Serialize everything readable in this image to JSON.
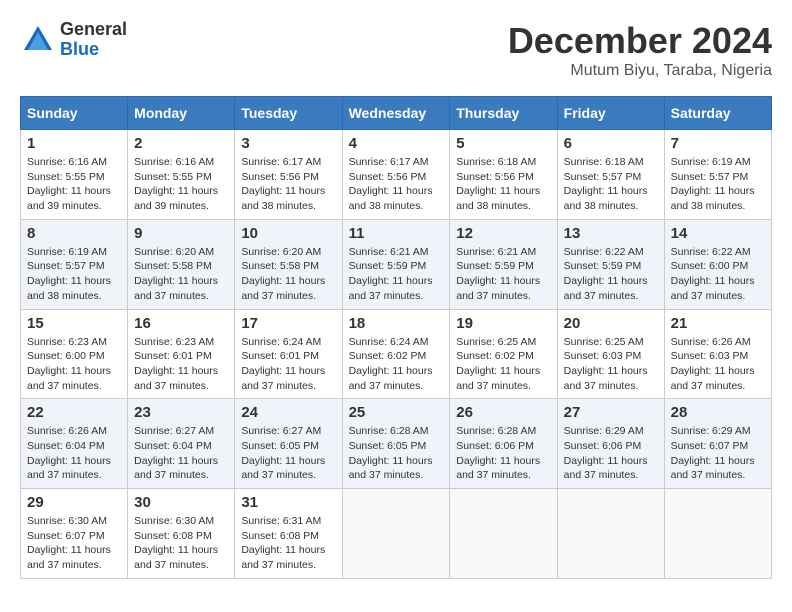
{
  "logo": {
    "general": "General",
    "blue": "Blue"
  },
  "title": "December 2024",
  "location": "Mutum Biyu, Taraba, Nigeria",
  "days_header": [
    "Sunday",
    "Monday",
    "Tuesday",
    "Wednesday",
    "Thursday",
    "Friday",
    "Saturday"
  ],
  "weeks": [
    [
      {
        "day": "1",
        "info": "Sunrise: 6:16 AM\nSunset: 5:55 PM\nDaylight: 11 hours\nand 39 minutes."
      },
      {
        "day": "2",
        "info": "Sunrise: 6:16 AM\nSunset: 5:55 PM\nDaylight: 11 hours\nand 39 minutes."
      },
      {
        "day": "3",
        "info": "Sunrise: 6:17 AM\nSunset: 5:56 PM\nDaylight: 11 hours\nand 38 minutes."
      },
      {
        "day": "4",
        "info": "Sunrise: 6:17 AM\nSunset: 5:56 PM\nDaylight: 11 hours\nand 38 minutes."
      },
      {
        "day": "5",
        "info": "Sunrise: 6:18 AM\nSunset: 5:56 PM\nDaylight: 11 hours\nand 38 minutes."
      },
      {
        "day": "6",
        "info": "Sunrise: 6:18 AM\nSunset: 5:57 PM\nDaylight: 11 hours\nand 38 minutes."
      },
      {
        "day": "7",
        "info": "Sunrise: 6:19 AM\nSunset: 5:57 PM\nDaylight: 11 hours\nand 38 minutes."
      }
    ],
    [
      {
        "day": "8",
        "info": "Sunrise: 6:19 AM\nSunset: 5:57 PM\nDaylight: 11 hours\nand 38 minutes."
      },
      {
        "day": "9",
        "info": "Sunrise: 6:20 AM\nSunset: 5:58 PM\nDaylight: 11 hours\nand 37 minutes."
      },
      {
        "day": "10",
        "info": "Sunrise: 6:20 AM\nSunset: 5:58 PM\nDaylight: 11 hours\nand 37 minutes."
      },
      {
        "day": "11",
        "info": "Sunrise: 6:21 AM\nSunset: 5:59 PM\nDaylight: 11 hours\nand 37 minutes."
      },
      {
        "day": "12",
        "info": "Sunrise: 6:21 AM\nSunset: 5:59 PM\nDaylight: 11 hours\nand 37 minutes."
      },
      {
        "day": "13",
        "info": "Sunrise: 6:22 AM\nSunset: 5:59 PM\nDaylight: 11 hours\nand 37 minutes."
      },
      {
        "day": "14",
        "info": "Sunrise: 6:22 AM\nSunset: 6:00 PM\nDaylight: 11 hours\nand 37 minutes."
      }
    ],
    [
      {
        "day": "15",
        "info": "Sunrise: 6:23 AM\nSunset: 6:00 PM\nDaylight: 11 hours\nand 37 minutes."
      },
      {
        "day": "16",
        "info": "Sunrise: 6:23 AM\nSunset: 6:01 PM\nDaylight: 11 hours\nand 37 minutes."
      },
      {
        "day": "17",
        "info": "Sunrise: 6:24 AM\nSunset: 6:01 PM\nDaylight: 11 hours\nand 37 minutes."
      },
      {
        "day": "18",
        "info": "Sunrise: 6:24 AM\nSunset: 6:02 PM\nDaylight: 11 hours\nand 37 minutes."
      },
      {
        "day": "19",
        "info": "Sunrise: 6:25 AM\nSunset: 6:02 PM\nDaylight: 11 hours\nand 37 minutes."
      },
      {
        "day": "20",
        "info": "Sunrise: 6:25 AM\nSunset: 6:03 PM\nDaylight: 11 hours\nand 37 minutes."
      },
      {
        "day": "21",
        "info": "Sunrise: 6:26 AM\nSunset: 6:03 PM\nDaylight: 11 hours\nand 37 minutes."
      }
    ],
    [
      {
        "day": "22",
        "info": "Sunrise: 6:26 AM\nSunset: 6:04 PM\nDaylight: 11 hours\nand 37 minutes."
      },
      {
        "day": "23",
        "info": "Sunrise: 6:27 AM\nSunset: 6:04 PM\nDaylight: 11 hours\nand 37 minutes."
      },
      {
        "day": "24",
        "info": "Sunrise: 6:27 AM\nSunset: 6:05 PM\nDaylight: 11 hours\nand 37 minutes."
      },
      {
        "day": "25",
        "info": "Sunrise: 6:28 AM\nSunset: 6:05 PM\nDaylight: 11 hours\nand 37 minutes."
      },
      {
        "day": "26",
        "info": "Sunrise: 6:28 AM\nSunset: 6:06 PM\nDaylight: 11 hours\nand 37 minutes."
      },
      {
        "day": "27",
        "info": "Sunrise: 6:29 AM\nSunset: 6:06 PM\nDaylight: 11 hours\nand 37 minutes."
      },
      {
        "day": "28",
        "info": "Sunrise: 6:29 AM\nSunset: 6:07 PM\nDaylight: 11 hours\nand 37 minutes."
      }
    ],
    [
      {
        "day": "29",
        "info": "Sunrise: 6:30 AM\nSunset: 6:07 PM\nDaylight: 11 hours\nand 37 minutes."
      },
      {
        "day": "30",
        "info": "Sunrise: 6:30 AM\nSunset: 6:08 PM\nDaylight: 11 hours\nand 37 minutes."
      },
      {
        "day": "31",
        "info": "Sunrise: 6:31 AM\nSunset: 6:08 PM\nDaylight: 11 hours\nand 37 minutes."
      },
      null,
      null,
      null,
      null
    ]
  ]
}
